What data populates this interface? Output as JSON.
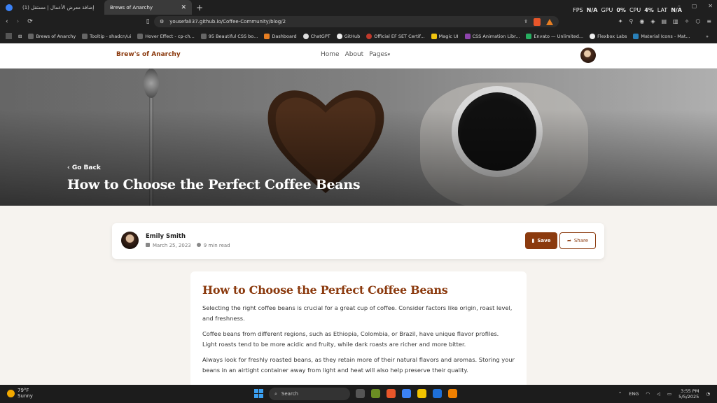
{
  "browser": {
    "tabs": [
      {
        "label": "(1) إضافة معرض الأعمال | مستقل",
        "active": false
      },
      {
        "label": "Brews of Anarchy",
        "active": true
      }
    ],
    "new_tab": "+",
    "perf": {
      "fps_label": "FPS",
      "fps_value": "N/A",
      "gpu_label": "GPU",
      "gpu_value": "0%",
      "cpu_label": "CPU",
      "cpu_value": "4%",
      "lat_label": "LAT",
      "lat_value": "N/A"
    },
    "url": "yousefali37.github.io/Coffee-Community/blog/2",
    "bookmarks": [
      "Brews of Anarchy",
      "Tooltip - shadcn/ui",
      "Hover Effect - cp-ch...",
      "95 Beautiful CSS bo...",
      "Dashboard",
      "ChatGPT",
      "GitHub",
      "Official EF SET Certif...",
      "Magic UI",
      "CSS Animation Libr...",
      "Envato — Unlimited...",
      "Flexbox Labs",
      "Material Icons - Mat..."
    ]
  },
  "site": {
    "brand": "Brew's of Anarchy",
    "nav": [
      "Home",
      "About",
      "Pages"
    ],
    "pages_caret": "▾",
    "hero": {
      "back": "Go Back",
      "title": "How to Choose the Perfect Coffee Beans"
    },
    "author": {
      "name": "Emily Smith",
      "date": "March 25, 2023",
      "read_time": "9 min read",
      "save": "Save",
      "share": "Share"
    },
    "article": {
      "title": "How to Choose the Perfect Coffee Beans",
      "paragraphs": [
        "Selecting the right coffee beans is crucial for a great cup of coffee. Consider factors like origin, roast level, and freshness.",
        "Coffee beans from different regions, such as Ethiopia, Colombia, or Brazil, have unique flavor profiles. Light roasts tend to be more acidic and fruity, while dark roasts are richer and more bitter.",
        "Always look for freshly roasted beans, as they retain more of their natural flavors and aromas. Storing your beans in an airtight container away from light and heat will also help preserve their quality."
      ]
    },
    "colors": {
      "accent": "#8b3a0e",
      "background": "#f6f3ef"
    }
  },
  "taskbar": {
    "weather": {
      "temp": "79°F",
      "condition": "Sunny"
    },
    "search": "Search",
    "lang": "ENG",
    "time": "3:55 PM",
    "date": "5/5/2025"
  }
}
